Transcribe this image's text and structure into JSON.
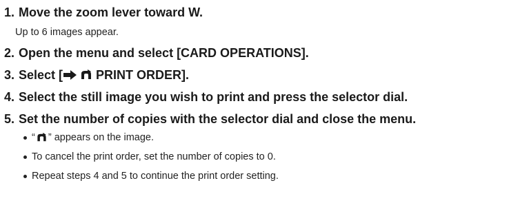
{
  "steps": [
    {
      "number": "1.",
      "text": "Move the zoom lever toward W."
    },
    {
      "number": "2.",
      "text": "Open the menu and select [CARD OPERATIONS]."
    },
    {
      "number": "3.",
      "text_prefix": "Select [",
      "text_suffix": " PRINT ORDER]."
    },
    {
      "number": "4.",
      "text": "Select the still image you wish to print and press the selector dial."
    },
    {
      "number": "5.",
      "text": "Set the number of copies with the selector dial and close the menu."
    }
  ],
  "step1_note": "Up to 6 images appear.",
  "step5_bullets": [
    {
      "prefix": "“ ",
      "suffix": " ” appears on the image."
    },
    {
      "text": "To cancel the print order, set the number of copies to 0."
    },
    {
      "text": "Repeat steps 4 and 5 to continue the print order setting."
    }
  ],
  "icons": {
    "arrow": "right-arrow-icon",
    "print_order": "print-order-icon"
  }
}
